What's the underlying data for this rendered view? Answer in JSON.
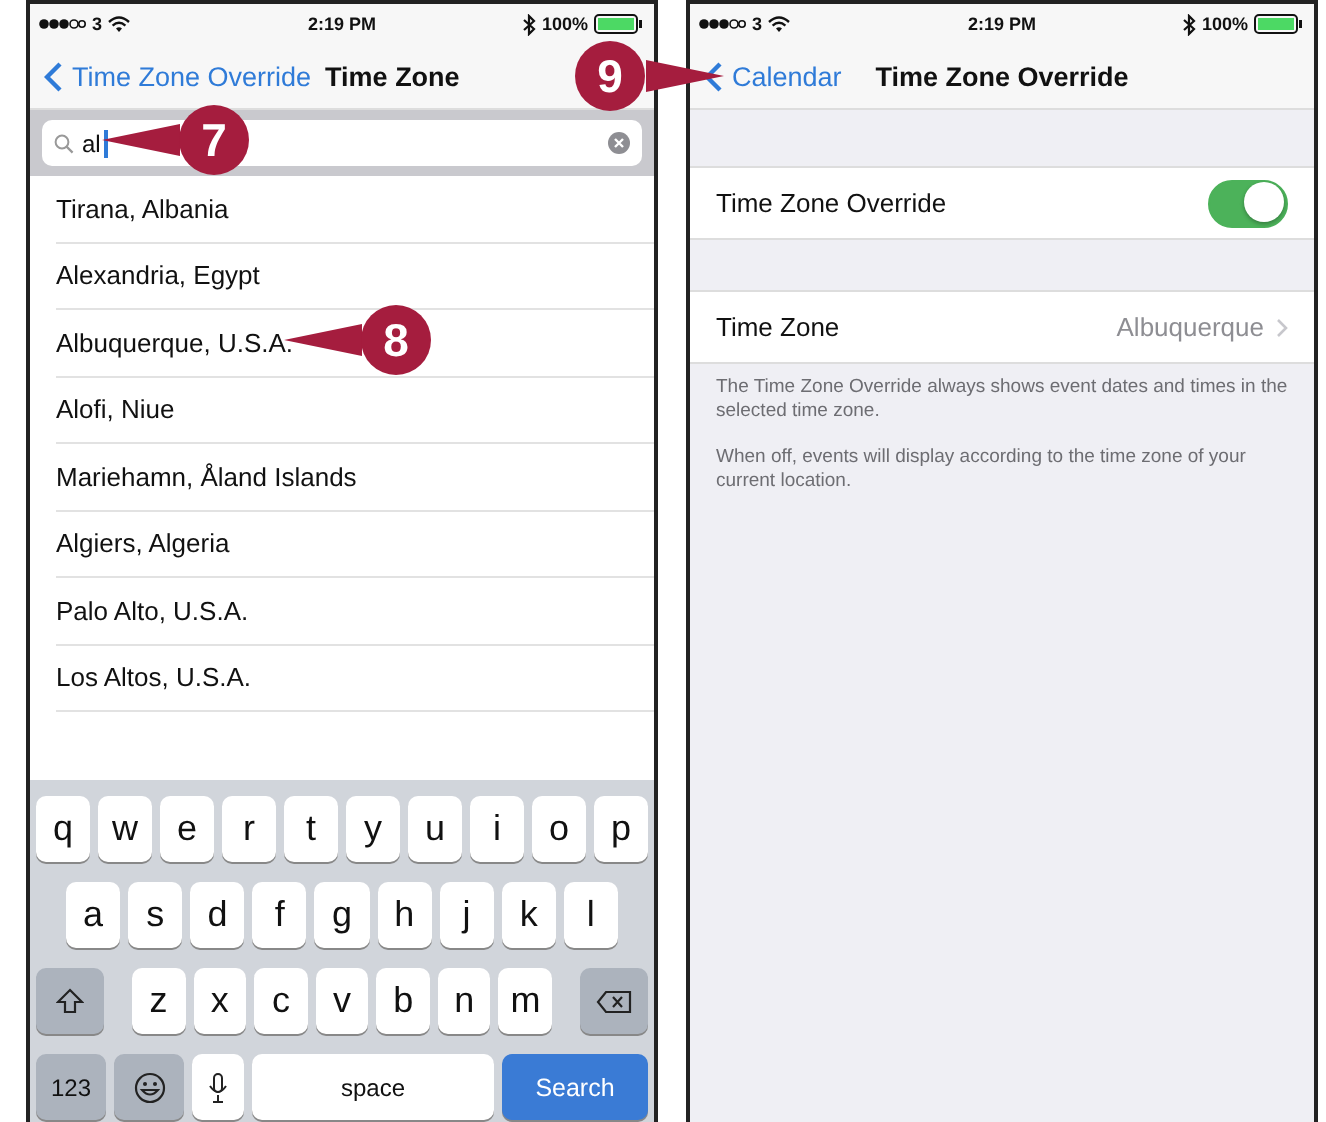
{
  "left_screen": {
    "status_bar": {
      "carrier": "3",
      "time": "2:19 PM",
      "battery": "100%"
    },
    "nav": {
      "back": "Time Zone Override",
      "title": "Time Zone"
    },
    "search": {
      "value": "al"
    },
    "results": [
      "Tirana, Albania",
      "Alexandria, Egypt",
      "Albuquerque, U.S.A.",
      "Alofi, Niue",
      "Mariehamn, Åland Islands",
      "Algiers, Algeria",
      "Palo Alto, U.S.A.",
      "Los Altos, U.S.A."
    ],
    "keyboard": {
      "rows": [
        [
          "q",
          "w",
          "e",
          "r",
          "t",
          "y",
          "u",
          "i",
          "o",
          "p"
        ],
        [
          "a",
          "s",
          "d",
          "f",
          "g",
          "h",
          "j",
          "k",
          "l"
        ],
        [
          "z",
          "x",
          "c",
          "v",
          "b",
          "n",
          "m"
        ]
      ],
      "numbers_key": "123",
      "space_key": "space",
      "search_key": "Search"
    }
  },
  "right_screen": {
    "status_bar": {
      "carrier": "3",
      "time": "2:19 PM",
      "battery": "100%"
    },
    "nav": {
      "back": "Calendar",
      "title": "Time Zone Override"
    },
    "override": {
      "label": "Time Zone Override",
      "on": true
    },
    "time_zone": {
      "label": "Time Zone",
      "value": "Albuquerque"
    },
    "notes": [
      "The Time Zone Override always shows event dates and times in the selected time zone.",
      "When off, events will display according to the time zone of your current location."
    ]
  },
  "callouts": [
    "7",
    "8",
    "9"
  ]
}
